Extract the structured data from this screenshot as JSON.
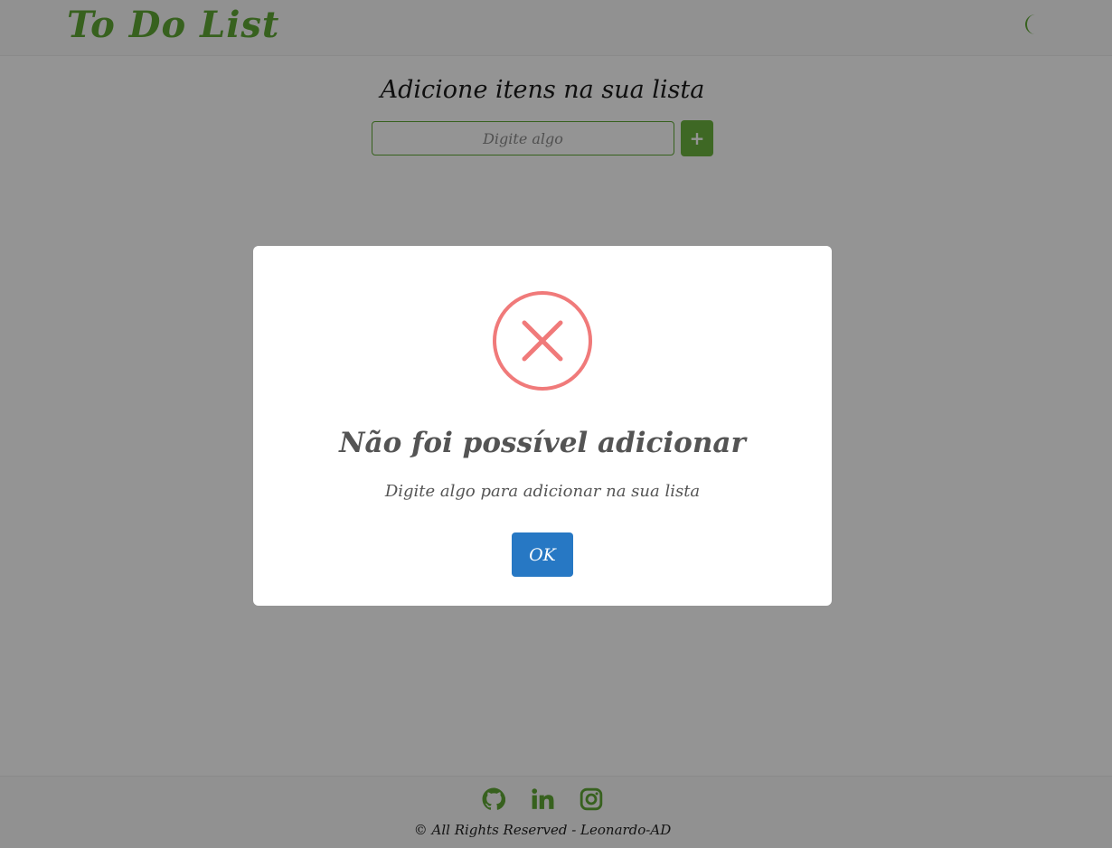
{
  "header": {
    "brand": "To Do List",
    "theme_toggle_icon": "moon-icon"
  },
  "main": {
    "title": "Adicione itens na sua lista",
    "input_placeholder": "Digite algo",
    "input_value": "",
    "add_label": "+"
  },
  "footer": {
    "social_icons": [
      "github-icon",
      "linkedin-icon",
      "instagram-icon"
    ],
    "copyright": "© All Rights Reserved - Leonardo-AD"
  },
  "modal": {
    "icon": "error-x-icon",
    "title": "Não foi possível adicionar",
    "text": "Digite algo para adicionar na sua lista",
    "ok_label": "OK"
  },
  "colors": {
    "brand_green": "#5fa834",
    "error_red": "#f07a7a",
    "ok_blue": "#2778c4"
  }
}
